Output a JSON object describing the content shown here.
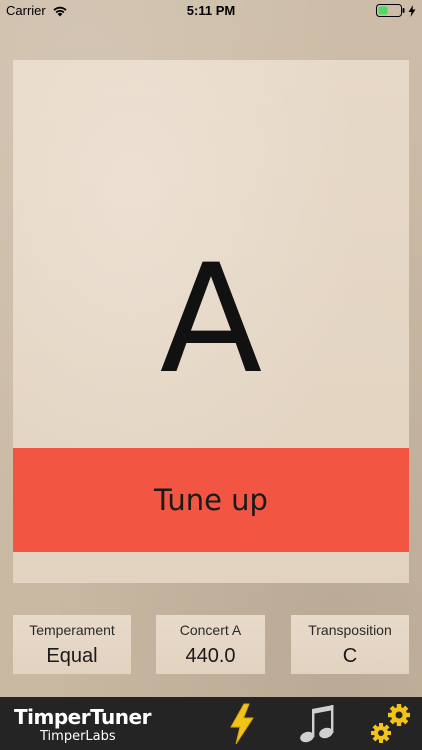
{
  "status_bar": {
    "carrier": "Carrier",
    "time": "5:11 PM",
    "icons": [
      "wifi-icon",
      "battery-icon",
      "charging-icon"
    ]
  },
  "tuner": {
    "note": "A",
    "status": "Tune up",
    "status_color": "#f25541"
  },
  "settings": {
    "temperament": {
      "label": "Temperament",
      "value": "Equal"
    },
    "concert_a": {
      "label": "Concert A",
      "value": "440.0"
    },
    "transposition": {
      "label": "Transposition",
      "value": "C"
    }
  },
  "bottom_bar": {
    "app_name": "TimperTuner",
    "company": "TimperLabs",
    "accent_color": "#f2c418",
    "tabs": [
      {
        "name": "tuner",
        "icon": "lightning-icon"
      },
      {
        "name": "music",
        "icon": "music-note-icon"
      },
      {
        "name": "settings",
        "icon": "gears-icon"
      }
    ]
  }
}
